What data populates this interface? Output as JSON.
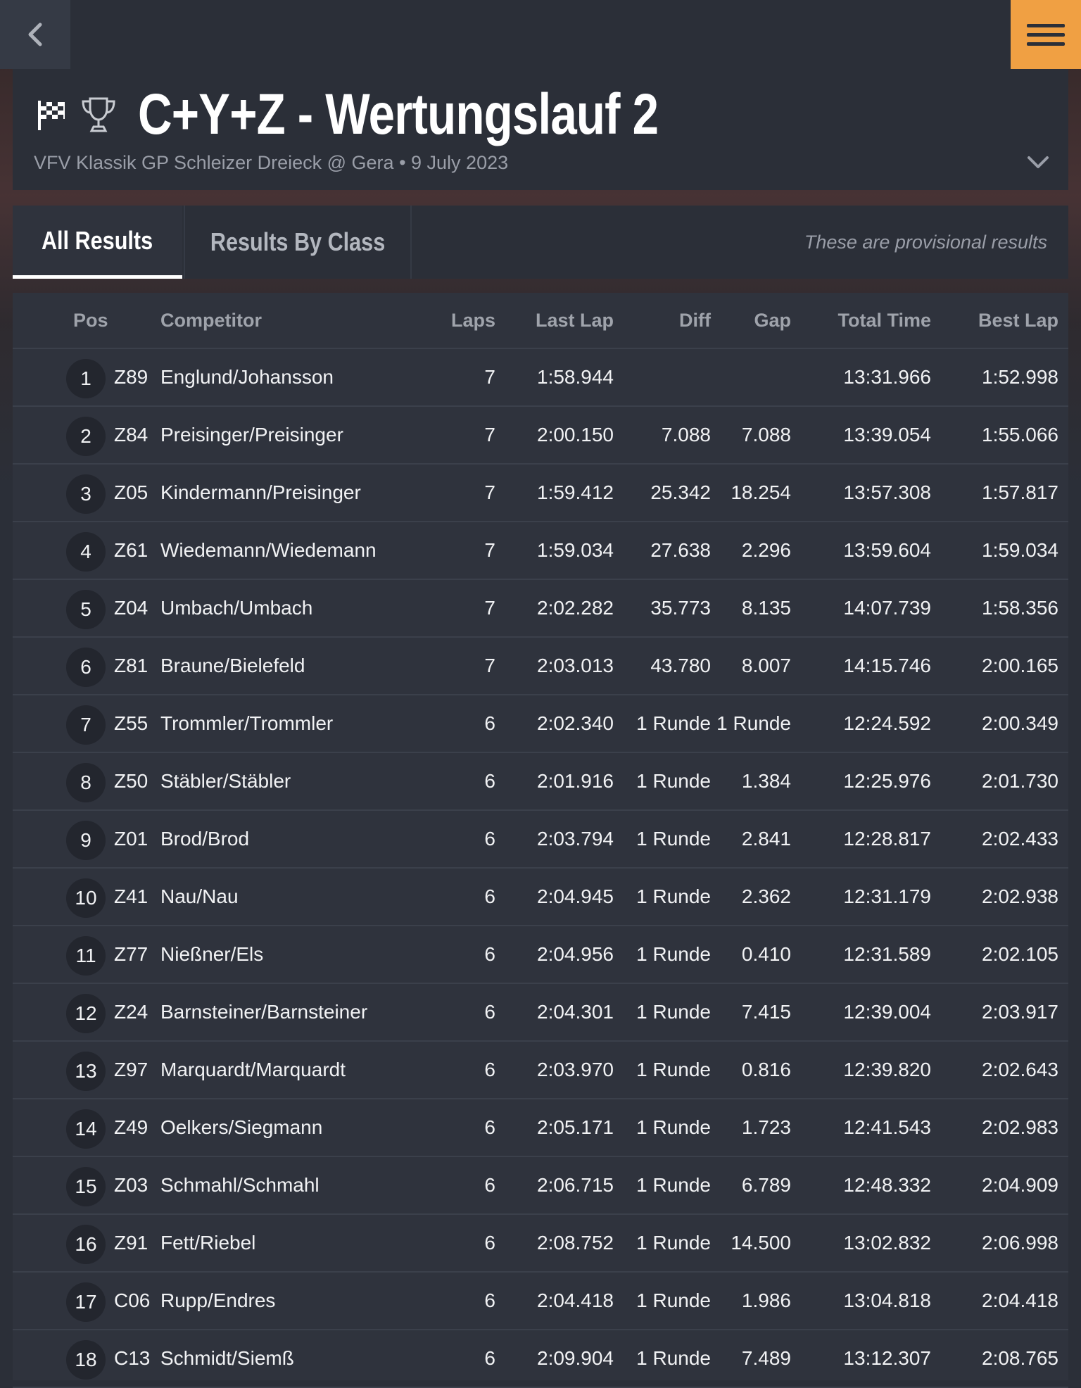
{
  "header": {
    "title": "C+Y+Z - Wertungslauf 2",
    "subtitle": "VFV Klassik GP Schleizer Dreieck @ Gera • 9 July 2023"
  },
  "tabs": {
    "all_results": "All Results",
    "results_by_class": "Results By Class",
    "provisional_note": "These are provisional results"
  },
  "columns": {
    "pos": "Pos",
    "competitor": "Competitor",
    "laps": "Laps",
    "last_lap": "Last Lap",
    "diff": "Diff",
    "gap": "Gap",
    "total_time": "Total Time",
    "best_lap": "Best Lap"
  },
  "results": [
    {
      "pos": "1",
      "num": "Z89",
      "name": "Englund/Johansson",
      "laps": "7",
      "last": "1:58.944",
      "diff": "",
      "gap": "",
      "total": "13:31.966",
      "best": "1:52.998"
    },
    {
      "pos": "2",
      "num": "Z84",
      "name": "Preisinger/Preisinger",
      "laps": "7",
      "last": "2:00.150",
      "diff": "7.088",
      "gap": "7.088",
      "total": "13:39.054",
      "best": "1:55.066"
    },
    {
      "pos": "3",
      "num": "Z05",
      "name": "Kindermann/Preisinger",
      "laps": "7",
      "last": "1:59.412",
      "diff": "25.342",
      "gap": "18.254",
      "total": "13:57.308",
      "best": "1:57.817"
    },
    {
      "pos": "4",
      "num": "Z61",
      "name": "Wiedemann/Wiedemann",
      "laps": "7",
      "last": "1:59.034",
      "diff": "27.638",
      "gap": "2.296",
      "total": "13:59.604",
      "best": "1:59.034"
    },
    {
      "pos": "5",
      "num": "Z04",
      "name": "Umbach/Umbach",
      "laps": "7",
      "last": "2:02.282",
      "diff": "35.773",
      "gap": "8.135",
      "total": "14:07.739",
      "best": "1:58.356"
    },
    {
      "pos": "6",
      "num": "Z81",
      "name": "Braune/Bielefeld",
      "laps": "7",
      "last": "2:03.013",
      "diff": "43.780",
      "gap": "8.007",
      "total": "14:15.746",
      "best": "2:00.165"
    },
    {
      "pos": "7",
      "num": "Z55",
      "name": "Trommler/Trommler",
      "laps": "6",
      "last": "2:02.340",
      "diff": "1 Runde",
      "gap": "1 Runde",
      "total": "12:24.592",
      "best": "2:00.349"
    },
    {
      "pos": "8",
      "num": "Z50",
      "name": "Stäbler/Stäbler",
      "laps": "6",
      "last": "2:01.916",
      "diff": "1 Runde",
      "gap": "1.384",
      "total": "12:25.976",
      "best": "2:01.730"
    },
    {
      "pos": "9",
      "num": "Z01",
      "name": "Brod/Brod",
      "laps": "6",
      "last": "2:03.794",
      "diff": "1 Runde",
      "gap": "2.841",
      "total": "12:28.817",
      "best": "2:02.433"
    },
    {
      "pos": "10",
      "num": "Z41",
      "name": "Nau/Nau",
      "laps": "6",
      "last": "2:04.945",
      "diff": "1 Runde",
      "gap": "2.362",
      "total": "12:31.179",
      "best": "2:02.938"
    },
    {
      "pos": "11",
      "num": "Z77",
      "name": "Nießner/Els",
      "laps": "6",
      "last": "2:04.956",
      "diff": "1 Runde",
      "gap": "0.410",
      "total": "12:31.589",
      "best": "2:02.105"
    },
    {
      "pos": "12",
      "num": "Z24",
      "name": "Barnsteiner/Barnsteiner",
      "laps": "6",
      "last": "2:04.301",
      "diff": "1 Runde",
      "gap": "7.415",
      "total": "12:39.004",
      "best": "2:03.917"
    },
    {
      "pos": "13",
      "num": "Z97",
      "name": "Marquardt/Marquardt",
      "laps": "6",
      "last": "2:03.970",
      "diff": "1 Runde",
      "gap": "0.816",
      "total": "12:39.820",
      "best": "2:02.643"
    },
    {
      "pos": "14",
      "num": "Z49",
      "name": "Oelkers/Siegmann",
      "laps": "6",
      "last": "2:05.171",
      "diff": "1 Runde",
      "gap": "1.723",
      "total": "12:41.543",
      "best": "2:02.983"
    },
    {
      "pos": "15",
      "num": "Z03",
      "name": "Schmahl/Schmahl",
      "laps": "6",
      "last": "2:06.715",
      "diff": "1 Runde",
      "gap": "6.789",
      "total": "12:48.332",
      "best": "2:04.909"
    },
    {
      "pos": "16",
      "num": "Z91",
      "name": "Fett/Riebel",
      "laps": "6",
      "last": "2:08.752",
      "diff": "1 Runde",
      "gap": "14.500",
      "total": "13:02.832",
      "best": "2:06.998"
    },
    {
      "pos": "17",
      "num": "C06",
      "name": "Rupp/Endres",
      "laps": "6",
      "last": "2:04.418",
      "diff": "1 Runde",
      "gap": "1.986",
      "total": "13:04.818",
      "best": "2:04.418"
    },
    {
      "pos": "18",
      "num": "C13",
      "name": "Schmidt/Siemß",
      "laps": "6",
      "last": "2:09.904",
      "diff": "1 Runde",
      "gap": "7.489",
      "total": "13:12.307",
      "best": "2:08.765"
    }
  ]
}
